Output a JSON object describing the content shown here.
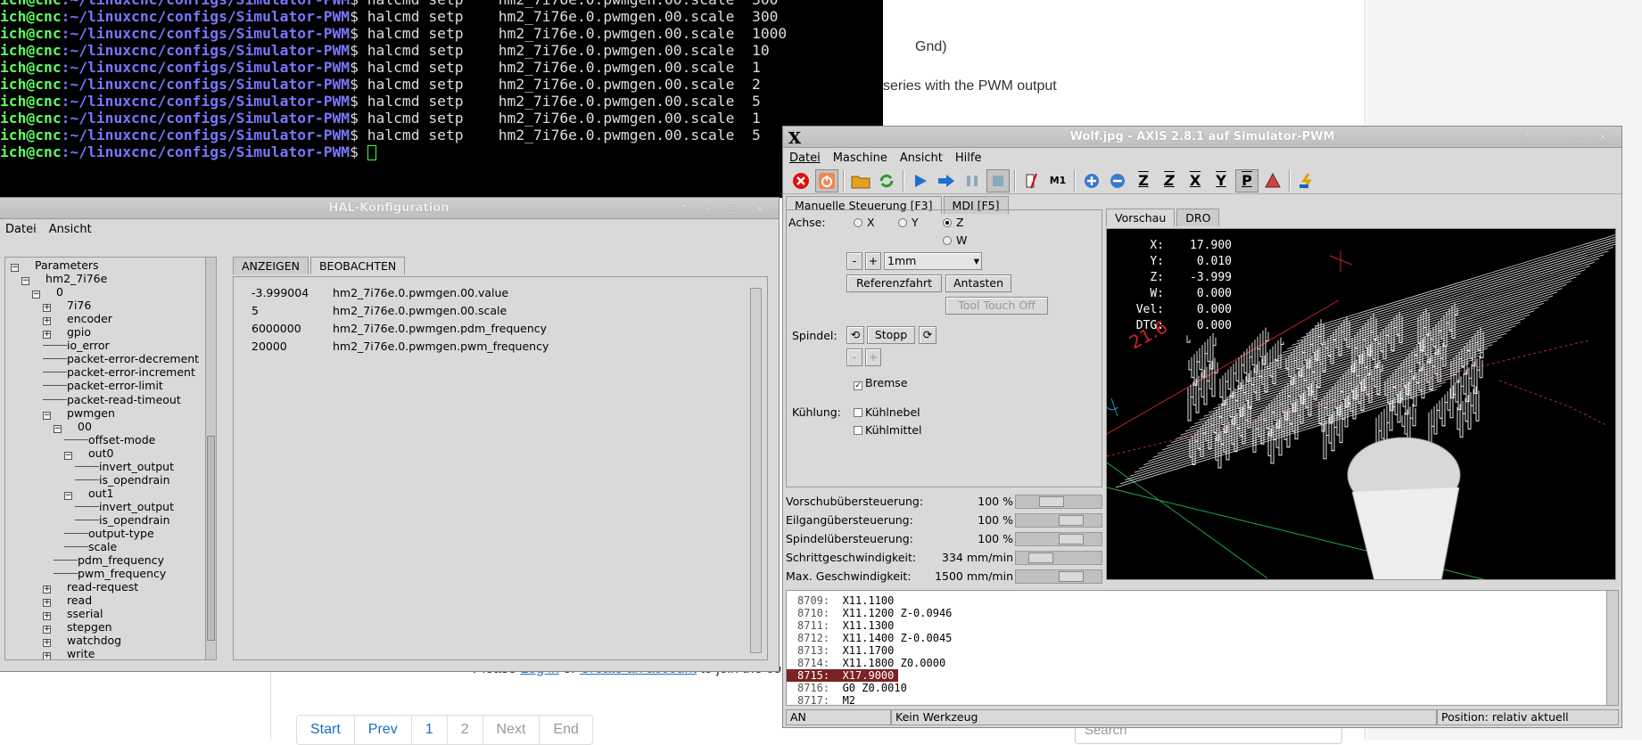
{
  "web": {
    "line1": "Gnd)",
    "line2": "series with the PWM output",
    "join_pre": "Please",
    "login": "Log in",
    "join_or": "or",
    "create": "Create an account",
    "join_post": "to join the co",
    "pager": [
      "Start",
      "Prev",
      "1",
      "2",
      "Next",
      "End"
    ],
    "search_placeholder": "Search"
  },
  "terminal": {
    "prompt_user": "ich@cnc",
    "prompt_dir": ":~/linuxcnc/configs/Simulator-PWM",
    "lines": [
      "halcmd setp    hm2_7i76e.0.pwmgen.00.scale  300",
      "halcmd setp    hm2_7i76e.0.pwmgen.00.scale  300",
      "halcmd setp    hm2_7i76e.0.pwmgen.00.scale  1000",
      "halcmd setp    hm2_7i76e.0.pwmgen.00.scale  10",
      "halcmd setp    hm2_7i76e.0.pwmgen.00.scale  1",
      "halcmd setp    hm2_7i76e.0.pwmgen.00.scale  2",
      "halcmd setp    hm2_7i76e.0.pwmgen.00.scale  5",
      "halcmd setp    hm2_7i76e.0.pwmgen.00.scale  1",
      "halcmd setp    hm2_7i76e.0.pwmgen.00.scale  5",
      ""
    ]
  },
  "hal": {
    "title": "HAL-Konfiguration",
    "menu": [
      "Datei",
      "Ansicht"
    ],
    "tree": [
      {
        "t": "Parameters",
        "d": 0
      },
      {
        "t": "hm2_7i76e",
        "d": 1
      },
      {
        "t": "0",
        "d": 2
      },
      {
        "t": "7i76",
        "d": 3
      },
      {
        "t": "encoder",
        "d": 3
      },
      {
        "t": "gpio",
        "d": 3
      },
      {
        "t": "io_error",
        "d": 3
      },
      {
        "t": "packet-error-decrement",
        "d": 3
      },
      {
        "t": "packet-error-increment",
        "d": 3
      },
      {
        "t": "packet-error-limit",
        "d": 3
      },
      {
        "t": "packet-read-timeout",
        "d": 3
      },
      {
        "t": "pwmgen",
        "d": 3
      },
      {
        "t": "00",
        "d": 4
      },
      {
        "t": "offset-mode",
        "d": 5
      },
      {
        "t": "out0",
        "d": 5
      },
      {
        "t": "invert_output",
        "d": 6
      },
      {
        "t": "is_opendrain",
        "d": 6
      },
      {
        "t": "out1",
        "d": 5
      },
      {
        "t": "invert_output",
        "d": 6
      },
      {
        "t": "is_opendrain",
        "d": 6
      },
      {
        "t": "output-type",
        "d": 5
      },
      {
        "t": "scale",
        "d": 5
      },
      {
        "t": "pdm_frequency",
        "d": 4
      },
      {
        "t": "pwm_frequency",
        "d": 4
      },
      {
        "t": "read-request",
        "d": 3
      },
      {
        "t": "read",
        "d": 3
      },
      {
        "t": "sserial",
        "d": 3
      },
      {
        "t": "stepgen",
        "d": 3
      },
      {
        "t": "watchdog",
        "d": 3
      },
      {
        "t": "write",
        "d": 3
      }
    ],
    "tabs": [
      "ANZEIGEN",
      "BEOBACHTEN"
    ],
    "watch": [
      {
        "value": "-3.999004",
        "name": "hm2_7i76e.0.pwmgen.00.value"
      },
      {
        "value": "5",
        "name": "hm2_7i76e.0.pwmgen.00.scale"
      },
      {
        "value": "6000000",
        "name": "hm2_7i76e.0.pwmgen.pdm_frequency"
      },
      {
        "value": "20000",
        "name": "hm2_7i76e.0.pwmgen.pwm_frequency"
      }
    ]
  },
  "axis": {
    "title": "Wolf.jpg - AXIS 2.8.1 auf  Simulator-PWM",
    "menu": [
      "Datei",
      "Maschine",
      "Ansicht",
      "Hilfe"
    ],
    "tab_manual": "Manuelle Steuerung [F3]",
    "tab_mdi": "MDI [F5]",
    "tab_preview": "Vorschau",
    "tab_dro": "DRO",
    "achse_label": "Achse:",
    "axes": [
      "X",
      "Y",
      "Z",
      "W"
    ],
    "minus": "-",
    "plus": "+",
    "jog_increment": "1mm",
    "home_button": "Referenzfahrt",
    "touch_button": "Antasten",
    "tool_touch_off": "Tool Touch Off",
    "spindle_label": "Spindel:",
    "spindle_stop": "Stopp",
    "brake": "Bremse",
    "coolant_label": "Kühlung:",
    "mist": "Kühlnebel",
    "flood": "Kühlmittel",
    "overrides": [
      {
        "label": "Vorschubübersteuerung:",
        "value": "100 %",
        "level": 0.38
      },
      {
        "label": "Eilgangübersteuerung:",
        "value": "100 %",
        "level": 0.7
      },
      {
        "label": "Spindelübersteuerung:",
        "value": "100 %",
        "level": 0.7
      },
      {
        "label": "Schrittgeschwindigkeit:",
        "value": "334 mm/min",
        "level": 0.2
      },
      {
        "label": "Max. Geschwindigkeit:",
        "value": "1500 mm/min",
        "level": 0.7
      }
    ],
    "dro": [
      {
        "k": "X:",
        "v": "17.900"
      },
      {
        "k": "Y:",
        "v": "0.010"
      },
      {
        "k": "Z:",
        "v": "-3.999"
      },
      {
        "k": "W:",
        "v": "0.000"
      },
      {
        "k": "Vel:",
        "v": "0.000"
      },
      {
        "k": "DTG:",
        "v": "0.000"
      }
    ],
    "dim_label": "21.6",
    "gcode": [
      {
        "n": "8709:",
        "c": "X11.1100"
      },
      {
        "n": "8710:",
        "c": "X11.1200 Z-0.0946"
      },
      {
        "n": "8711:",
        "c": "X11.1300"
      },
      {
        "n": "8712:",
        "c": "X11.1400 Z-0.0045"
      },
      {
        "n": "8713:",
        "c": "X11.1700"
      },
      {
        "n": "8714:",
        "c": "X11.1800 Z0.0000"
      },
      {
        "n": "8715:",
        "c": "X17.9000"
      },
      {
        "n": "8716:",
        "c": "G0 Z0.0010"
      },
      {
        "n": "8717:",
        "c": "M2"
      }
    ],
    "status": [
      "AN",
      "Kein Werkzeug",
      "Position: relativ aktuell"
    ],
    "colors": {
      "selected_line": "#7a2222",
      "grid": "#cc2222",
      "toolpath": "#ffffff"
    }
  }
}
